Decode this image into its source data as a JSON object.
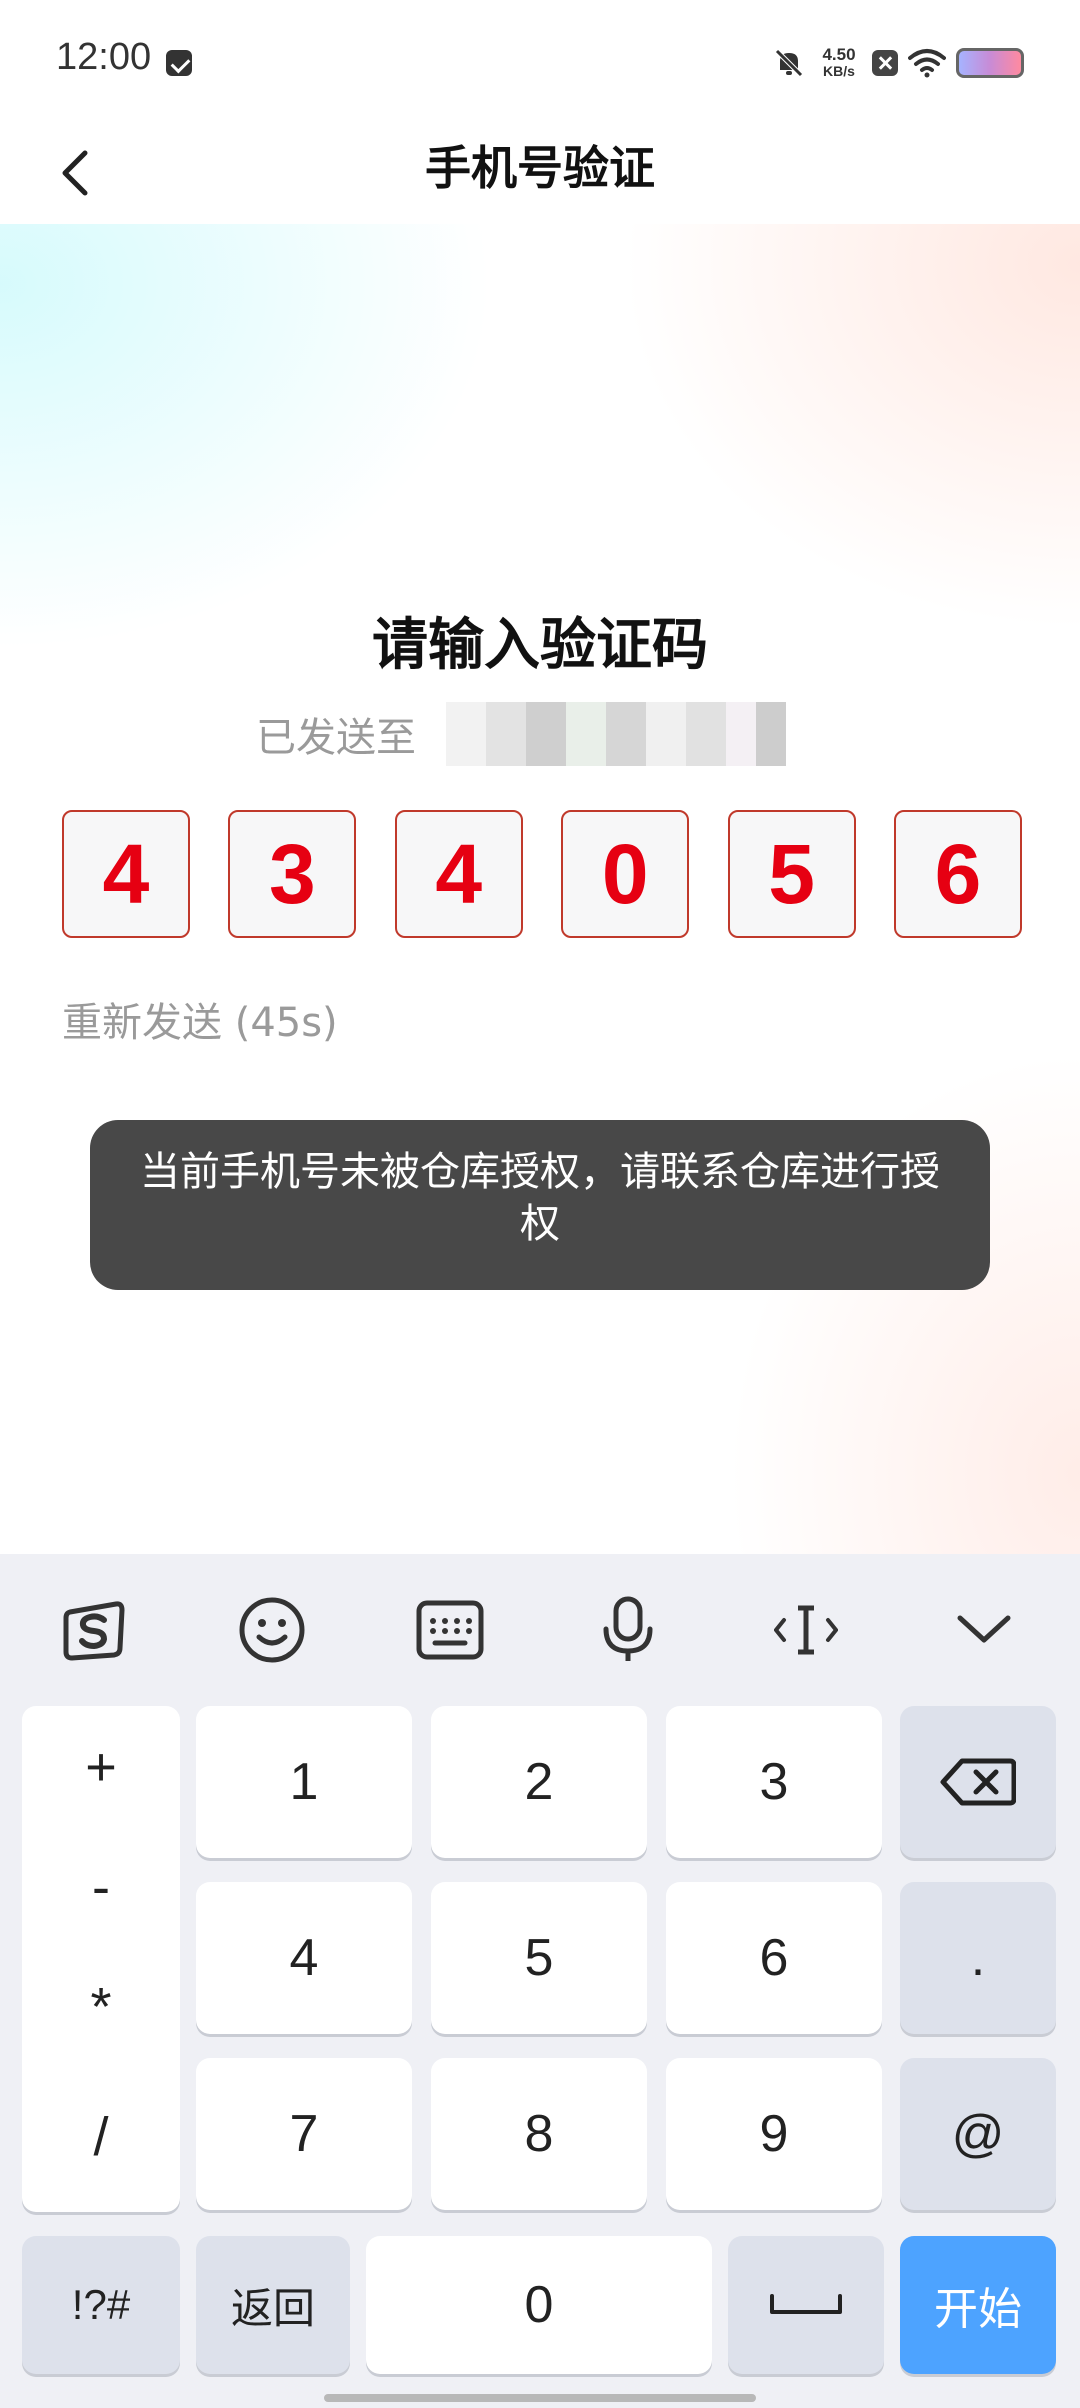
{
  "status_bar": {
    "time": "12:00",
    "speed_value": "4.50",
    "speed_unit": "KB/s",
    "icons": [
      "notification-icon",
      "mute-icon",
      "close-box-icon",
      "wifi-icon",
      "battery-icon"
    ]
  },
  "header": {
    "title": "手机号验证",
    "back_icon": "chevron-left-icon"
  },
  "main": {
    "title": "请输入验证码",
    "sent_label": "已发送至",
    "code_digits": [
      "4",
      "3",
      "4",
      "0",
      "5",
      "6"
    ],
    "resend": "重新发送 (45s)",
    "toast": "当前手机号未被仓库授权，请联系仓库进行授权"
  },
  "keyboard": {
    "toolbar": [
      "sogou-logo-icon",
      "emoji-icon",
      "keyboard-icon",
      "microphone-icon",
      "cursor-icon",
      "collapse-icon"
    ],
    "symbols": [
      "+",
      "-",
      "*",
      "/"
    ],
    "digits": [
      "1",
      "2",
      "3",
      "4",
      "5",
      "6",
      "7",
      "8",
      "9"
    ],
    "right_keys": [
      ".",
      "@"
    ],
    "bottom": {
      "symbols": "!?#",
      "back": "返回",
      "zero": "0",
      "start": "开始"
    }
  },
  "colors": {
    "accent_blue": "#4da3ff",
    "code_red": "#e60012",
    "toast_bg": "#484848"
  }
}
